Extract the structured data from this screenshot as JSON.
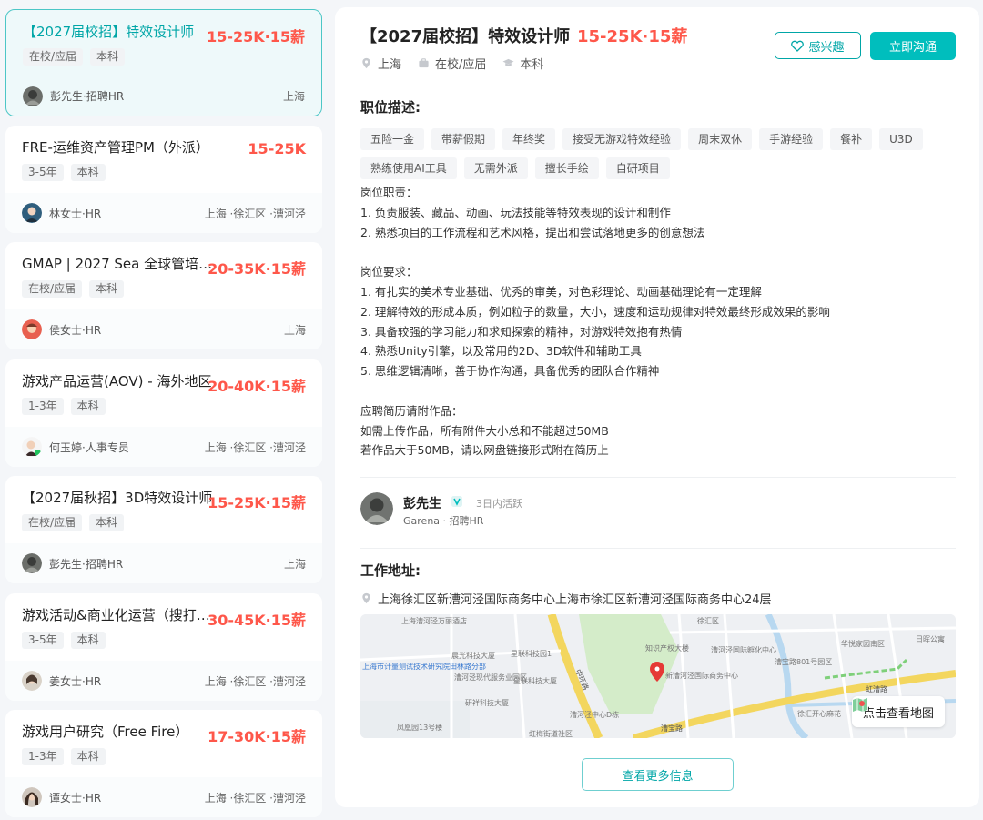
{
  "jobs": [
    {
      "title": "【2027届校招】特效设计师",
      "salary": "15-25K·15薪",
      "tags": [
        "在校/应届",
        "本科"
      ],
      "hr": "彭先生·招聘HR",
      "location": "上海"
    },
    {
      "title": "FRE-运维资产管理PM（外派）",
      "salary": "15-25K",
      "tags": [
        "3-5年",
        "本科"
      ],
      "hr": "林女士·HR",
      "location": "上海 ·徐汇区 ·漕河泾"
    },
    {
      "title": "GMAP | 2027 Sea 全球管培生…",
      "salary": "20-35K·15薪",
      "tags": [
        "在校/应届",
        "本科"
      ],
      "hr": "侯女士·HR",
      "location": "上海"
    },
    {
      "title": "游戏产品运营(AOV) - 海外地区",
      "salary": "20-40K·15薪",
      "tags": [
        "1-3年",
        "本科"
      ],
      "hr": "何玉婷·人事专员",
      "location": "上海 ·徐汇区 ·漕河泾"
    },
    {
      "title": "【2027届秋招】3D特效设计师",
      "salary": "15-25K·15薪",
      "tags": [
        "在校/应届",
        "本科"
      ],
      "hr": "彭先生·招聘HR",
      "location": "上海"
    },
    {
      "title": "游戏活动&商业化运营（搜打撤）",
      "salary": "30-45K·15薪",
      "tags": [
        "3-5年",
        "本科"
      ],
      "hr": "姜女士·HR",
      "location": "上海 ·徐汇区 ·漕河泾"
    },
    {
      "title": "游戏用户研究（Free Fire）",
      "salary": "17-30K·15薪",
      "tags": [
        "1-3年",
        "本科"
      ],
      "hr": "谭女士·HR",
      "location": "上海 ·徐汇区 ·漕河泾"
    }
  ],
  "detail": {
    "title": "【2027届校招】特效设计师",
    "salary": "15-25K·15薪",
    "meta": {
      "city": "上海",
      "experience": "在校/应届",
      "degree": "本科"
    },
    "interest_label": "感兴趣",
    "chat_label": "立即沟通",
    "desc_title": "职位描述:",
    "keywords": [
      "五险一金",
      "带薪假期",
      "年终奖",
      "接受无游戏特效经验",
      "周末双休",
      "手游经验",
      "餐补",
      "U3D",
      "熟练使用AI工具",
      "无需外派",
      "擅长手绘",
      "自研项目"
    ],
    "desc_lines": [
      "岗位职责：",
      "1. 负责服装、藏品、动画、玩法技能等特效表现的设计和制作",
      "2. 熟悉项目的工作流程和艺术风格，提出和尝试落地更多的创意想法",
      "",
      "岗位要求：",
      "1. 有扎实的美术专业基础、优秀的审美，对色彩理论、动画基础理论有一定理解",
      "2. 理解特效的形成本质，例如粒子的数量，大小，速度和运动规律对特效最终形成效果的影响",
      "3. 具备较强的学习能力和求知探索的精神，对游戏特效抱有热情",
      "4. 熟悉Unity引擎，以及常用的2D、3D软件和辅助工具",
      "5. 思维逻辑清晰，善于协作沟通，具备优秀的团队合作精神",
      "",
      "应聘简历请附作品：",
      "如需上传作品，所有附件大小总和不能超过50MB",
      "若作品大于50MB，请以网盘链接形式附在简历上"
    ],
    "boss": {
      "name": "彭先生",
      "active": "3日内活跃",
      "company": "Garena · 招聘HR"
    },
    "address_title": "工作地址:",
    "address": "上海徐汇区新漕河泾国际商务中心上海市徐汇区新漕河泾国际商务中心24层",
    "map": {
      "view_map_label": "点击查看地图",
      "labels": [
        "上海漕河泾万丽酒店",
        "晨光科技大厦",
        "星联科技园1",
        "知识产权大楼",
        "漕河泾国际孵化中心",
        "新漕河泾国际商务中心",
        "上海市计量测试技术研究院田林路分部",
        "漕河泾现代服务业园区",
        "星联科技大厦",
        "研祥科技大厦",
        "漕河泾中心D栋",
        "中环路",
        "漕宝路",
        "虹漕路",
        "凤凰园13号楼",
        "华悦家园南区",
        "日晖公寓",
        "徐汇开心麻花",
        "虹梅街道社区",
        "漕宝路801号园区",
        "徐汇区"
      ]
    },
    "more_label": "查看更多信息"
  },
  "colors": {
    "accent": "#00bebd",
    "salary": "#fe574a"
  }
}
